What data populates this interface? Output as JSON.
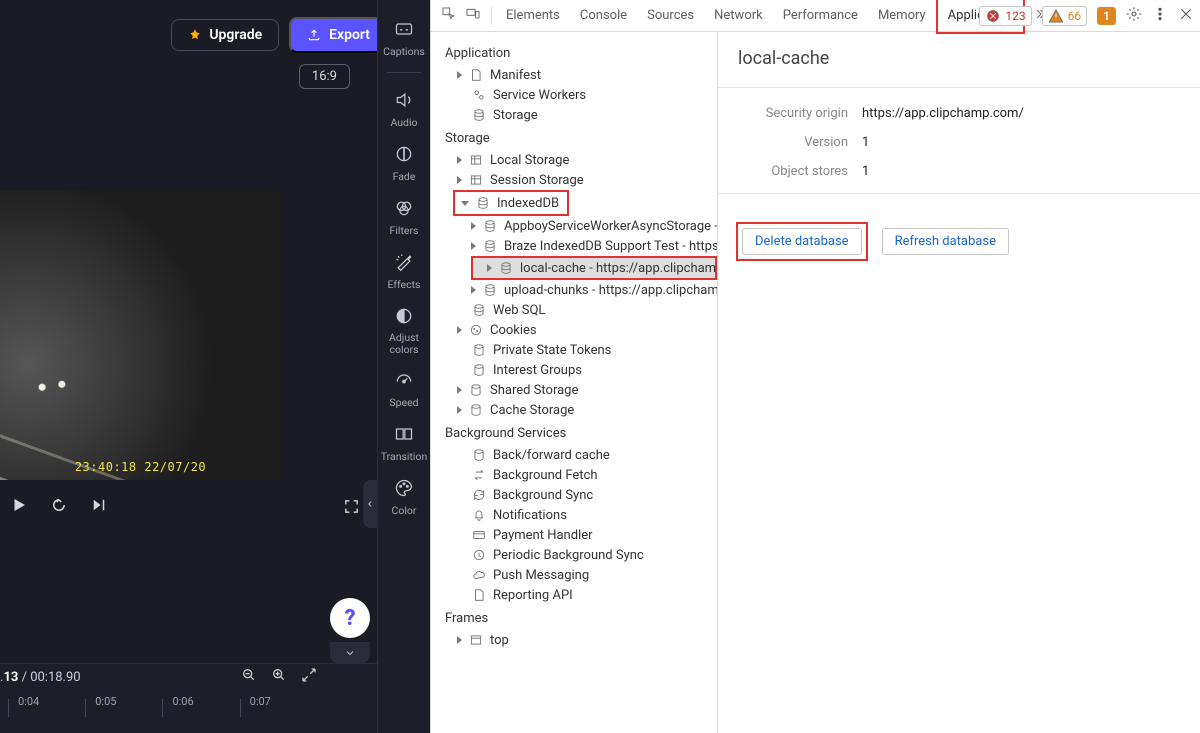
{
  "editor": {
    "upgrade_label": "Upgrade",
    "export_label": "Export",
    "aspect": "16:9",
    "preview_timestamp": "23:40:18   22/07/20",
    "time_current": "13",
    "time_total": "00:18.90",
    "ruler": [
      "0:04",
      "0:05",
      "0:06",
      "0:07"
    ],
    "tools": [
      {
        "name": "captions",
        "label": "Captions"
      },
      {
        "name": "audio",
        "label": "Audio"
      },
      {
        "name": "fade",
        "label": "Fade"
      },
      {
        "name": "filters",
        "label": "Filters"
      },
      {
        "name": "effects",
        "label": "Effects"
      },
      {
        "name": "adjust-colors",
        "label": "Adjust colors"
      },
      {
        "name": "speed",
        "label": "Speed"
      },
      {
        "name": "transition",
        "label": "Transition"
      },
      {
        "name": "color",
        "label": "Color"
      }
    ]
  },
  "devtools": {
    "tabs": [
      "Elements",
      "Console",
      "Sources",
      "Network",
      "Performance",
      "Memory",
      "Application"
    ],
    "active_tab": "Application",
    "errors": "123",
    "warnings": "66",
    "issues": "1",
    "sections": {
      "application": {
        "title": "Application",
        "items": [
          "Manifest",
          "Service Workers",
          "Storage"
        ]
      },
      "storage": {
        "title": "Storage",
        "items": [
          "Local Storage",
          "Session Storage",
          "IndexedDB",
          "Web SQL",
          "Cookies",
          "Private State Tokens",
          "Interest Groups",
          "Shared Storage",
          "Cache Storage"
        ],
        "indexeddb": [
          "AppboyServiceWorkerAsyncStorage - https://…",
          "Braze IndexedDB Support Test - https://app.cl…",
          "local-cache - https://app.clipchamp.com/",
          "upload-chunks - https://app.clipchamp.com/"
        ]
      },
      "bg": {
        "title": "Background Services",
        "items": [
          "Back/forward cache",
          "Background Fetch",
          "Background Sync",
          "Notifications",
          "Payment Handler",
          "Periodic Background Sync",
          "Push Messaging",
          "Reporting API"
        ]
      },
      "frames": {
        "title": "Frames",
        "items": [
          "top"
        ]
      }
    },
    "detail": {
      "title": "local-cache",
      "origin_label": "Security origin",
      "origin": "https://app.clipchamp.com/",
      "version_label": "Version",
      "version": "1",
      "stores_label": "Object stores",
      "stores": "1",
      "delete_btn": "Delete database",
      "refresh_btn": "Refresh database"
    }
  }
}
